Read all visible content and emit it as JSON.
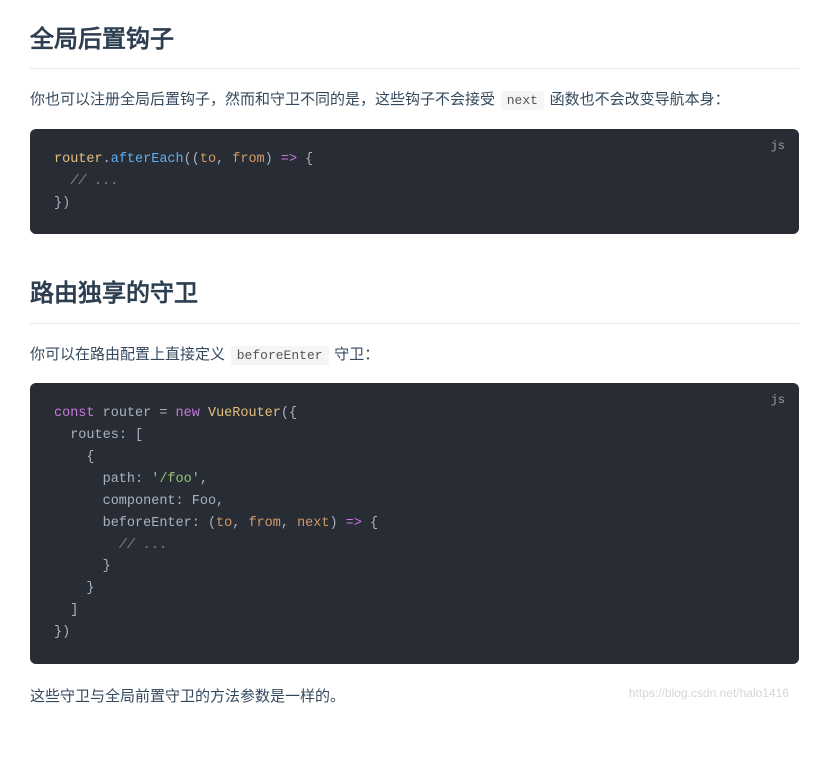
{
  "section1": {
    "heading": "全局后置钩子",
    "para_before": "你也可以注册全局后置钩子，然而和守卫不同的是，这些钩子不会接受 ",
    "inline_code": "next",
    "para_after": " 函数也不会改变导航本身：",
    "code_lang": "js",
    "code": {
      "l1_a": "router",
      "l1_b": ".",
      "l1_c": "afterEach",
      "l1_d": "((",
      "l1_e": "to",
      "l1_f": ", ",
      "l1_g": "from",
      "l1_h": ") ",
      "l1_i": "=>",
      "l1_j": " {",
      "l2": "  // ...",
      "l3": "})"
    }
  },
  "section2": {
    "heading": "路由独享的守卫",
    "para_before": "你可以在路由配置上直接定义 ",
    "inline_code": "beforeEnter",
    "para_after": " 守卫：",
    "code_lang": "js",
    "code": {
      "l1_a": "const",
      "l1_b": " router ",
      "l1_c": "=",
      "l1_d": " ",
      "l1_e": "new",
      "l1_f": " ",
      "l1_g": "VueRouter",
      "l1_h": "({",
      "l2_a": "  routes",
      "l2_b": ":",
      "l2_c": " [",
      "l3": "    {",
      "l4_a": "      path",
      "l4_b": ":",
      "l4_c": " ",
      "l4_d": "'/foo'",
      "l4_e": ",",
      "l5_a": "      component",
      "l5_b": ":",
      "l5_c": " Foo,",
      "l6_a": "      beforeEnter",
      "l6_b": ":",
      "l6_c": " (",
      "l6_d": "to",
      "l6_e": ", ",
      "l6_f": "from",
      "l6_g": ", ",
      "l6_h": "next",
      "l6_i": ") ",
      "l6_j": "=>",
      "l6_k": " {",
      "l7": "        // ...",
      "l8": "      }",
      "l9": "    }",
      "l10": "  ]",
      "l11": "})"
    },
    "para2": "这些守卫与全局前置守卫的方法参数是一样的。"
  },
  "watermark": "https://blog.csdn.net/halo1416"
}
